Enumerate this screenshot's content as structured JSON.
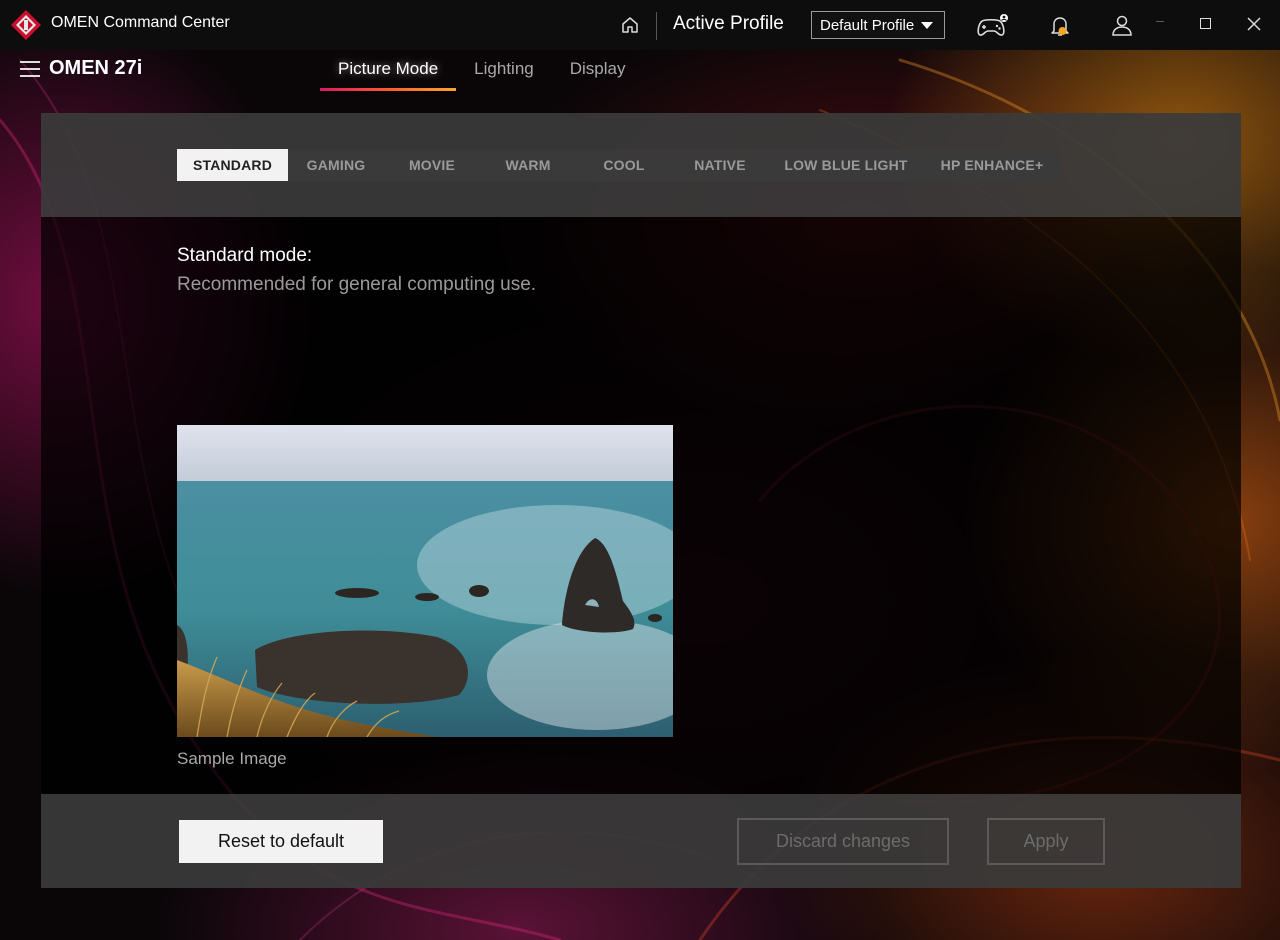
{
  "titlebar": {
    "app_title": "OMEN Command Center",
    "active_profile_label": "Active Profile",
    "profile_selected": "Default Profile"
  },
  "device": {
    "name": "OMEN 27i"
  },
  "tabs": [
    {
      "label": "Picture Mode",
      "active": true
    },
    {
      "label": "Lighting",
      "active": false
    },
    {
      "label": "Display",
      "active": false
    }
  ],
  "modes": [
    {
      "label": "STANDARD",
      "active": true
    },
    {
      "label": "GAMING",
      "active": false
    },
    {
      "label": "MOVIE",
      "active": false
    },
    {
      "label": "WARM",
      "active": false
    },
    {
      "label": "COOL",
      "active": false
    },
    {
      "label": "NATIVE",
      "active": false
    },
    {
      "label": "LOW BLUE LIGHT",
      "active": false
    },
    {
      "label": "HP ENHANCE+",
      "active": false
    }
  ],
  "content": {
    "mode_title": "Standard mode:",
    "mode_description": "Recommended for general computing use.",
    "sample_caption": "Sample Image"
  },
  "footer": {
    "reset_label": "Reset to default",
    "discard_label": "Discard changes",
    "apply_label": "Apply"
  },
  "colors": {
    "accent_start": "#d81b60",
    "accent_end": "#ffa726",
    "notification_dot": "#f5a623"
  },
  "icons": [
    "omen-logo-icon",
    "home-icon",
    "gamepad-icon",
    "bell-icon",
    "user-icon",
    "minimize-icon",
    "maximize-icon",
    "close-icon",
    "hamburger-icon"
  ]
}
